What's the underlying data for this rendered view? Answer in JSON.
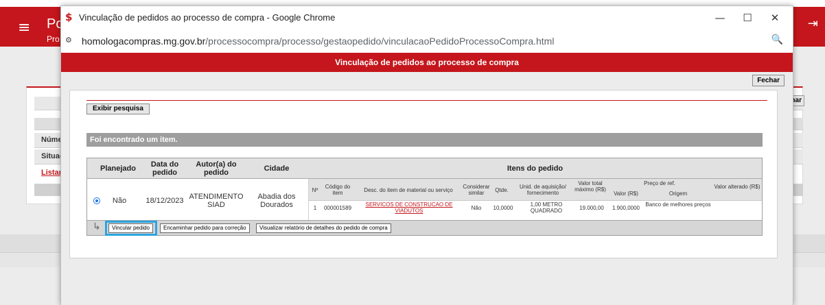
{
  "background": {
    "title_partial": "Po",
    "subtitle_partial": "Pro",
    "rows": [
      "Núme",
      "Situaç"
    ],
    "link_partial": "Listar c",
    "fechar": "char"
  },
  "window": {
    "title": "Vinculação de pedidos ao processo de compra - Google Chrome",
    "url_host": "homologacompras.mg.gov.br",
    "url_path": "/processocompra/processo/gestaopedido/vinculacaoPedidoProcessoCompra.html",
    "minimize": "—",
    "maximize": "☐",
    "close": "✕"
  },
  "page": {
    "header": "Vinculação de pedidos ao processo de compra",
    "fechar_label": "Fechar",
    "exibir_label": "Exibir pesquisa",
    "found_text": "Foi encontrado um item."
  },
  "table": {
    "headers": {
      "planejado": "Planejado",
      "data": "Data do pedido",
      "autor": "Autor(a) do pedido",
      "cidade": "Cidade",
      "itens": "Itens do pedido"
    },
    "row": {
      "planejado": "Não",
      "data": "18/12/2023",
      "autor": "ATENDIMENTO SIAD",
      "cidade": "Abadia dos Dourados"
    },
    "item_headers": {
      "n": "Nº",
      "codigo": "Código do item",
      "desc": "Desc. do item de material ou serviço",
      "similar": "Considerar similar",
      "qtde": "Qtde.",
      "unid": "Unid. de aquisição/ fornecimento",
      "valor_total": "Valor total máximo (R$)",
      "preco_ref": "Preço de ref.",
      "valor": "Valor (R$)",
      "origem": "Origem",
      "valor_alterado": "Valor alterado (R$)"
    },
    "item": {
      "n": "1",
      "codigo": "000001589",
      "desc": "SERVICOS DE CONSTRUCAO DE VIADUTOS",
      "similar": "Não",
      "qtde": "10,0000",
      "unid": "1,00 METRO QUADRADO",
      "valor_total": "19.000,00",
      "valor": "1.900,0000",
      "origem": "Banco de melhores preços",
      "valor_alterado": ""
    }
  },
  "actions": {
    "vincular": "Vincular pedido",
    "encaminhar": "Encaminhar pedido para correção",
    "visualizar": "Visualizar relatório de detalhes do pedido de compra"
  }
}
